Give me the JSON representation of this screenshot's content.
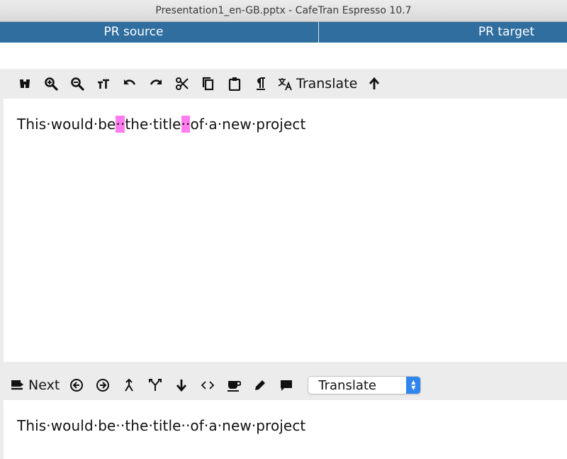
{
  "window": {
    "title": "Presentation1_en-GB.pptx - CafeTran Espresso 10.7"
  },
  "columns": {
    "source": "PR source",
    "target": "PR target"
  },
  "top_toolbar": {
    "translate_label": "Translate",
    "icons": [
      "binoculars-icon",
      "zoom-in-icon",
      "zoom-out-icon",
      "font-size-icon",
      "undo-icon",
      "redo-icon",
      "cut-icon",
      "copy-icon",
      "paste-icon",
      "pilcrow-icon",
      "translate-icon",
      "arrow-up-icon"
    ]
  },
  "source_segment": {
    "parts": [
      "This·would·be",
      "··",
      "the·title",
      "··",
      "of·a·new·project"
    ]
  },
  "bottom_toolbar": {
    "next_label": "Next",
    "dropdown_value": "Translate",
    "icons": [
      "next-segment-icon",
      "prev-circle-icon",
      "next-circle-icon",
      "merge-icon",
      "split-icon",
      "arrow-down-icon",
      "tags-icon",
      "coffee-icon",
      "pencil-icon",
      "comment-icon"
    ]
  },
  "target_segment": {
    "text": "This·would·be··the·title··of·a·new·project"
  },
  "colors": {
    "header_bar": "#2f6e9f",
    "space_highlight": "#ff7cf0",
    "dropdown_accent": "#2f86ef"
  }
}
